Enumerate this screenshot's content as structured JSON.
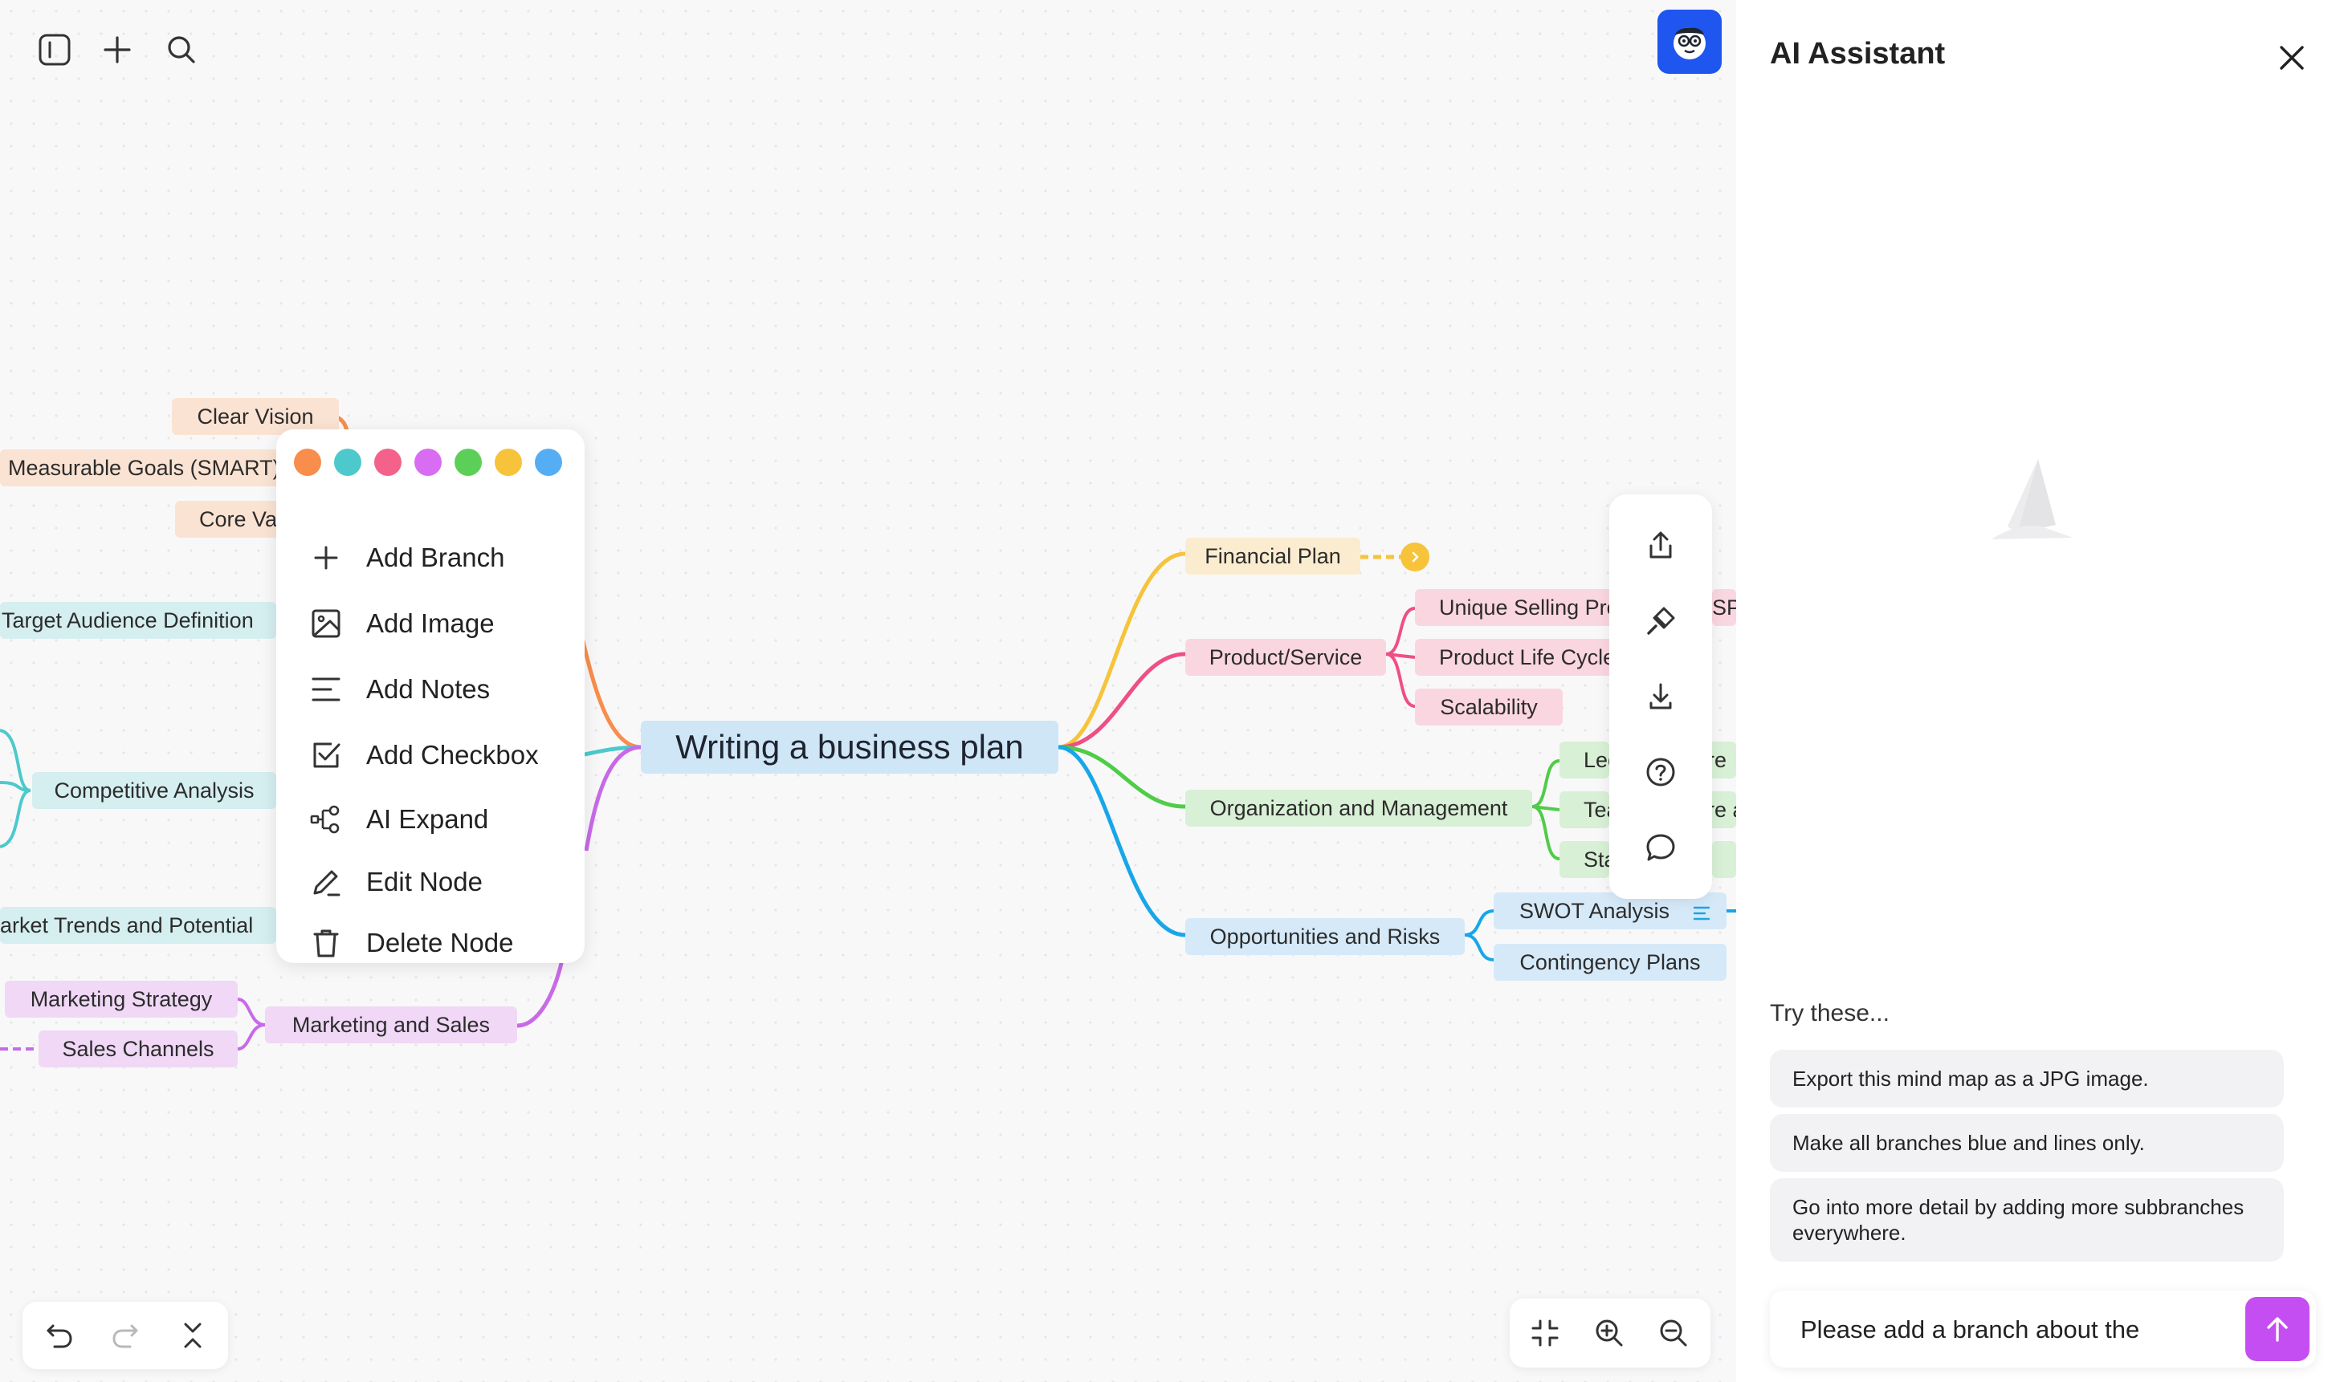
{
  "toolbar": {
    "sidebar_icon": "sidebar-toggle-icon",
    "add_icon": "plus-icon",
    "search_icon": "search-icon"
  },
  "mindmap": {
    "root": "Writing a business plan",
    "left_nodes": {
      "clear_vision": "Clear Vision",
      "measurable_goals": "Measurable Goals (SMART)",
      "core_values": "Core Val",
      "target_audience": "Target Audience Definition",
      "competitive_analysis": "Competitive Analysis",
      "market_trends": "arket Trends and Potential",
      "marketing_strategy": "Marketing Strategy",
      "sales_channels": "Sales Channels",
      "marketing_sales": "Marketing and Sales"
    },
    "right_nodes": {
      "financial_plan": "Financial Plan",
      "product_service": "Product/Service",
      "unique_selling": "Unique Selling Pro",
      "usp_suffix": "SP",
      "product_life_cycle": "Product Life Cycle",
      "scalability": "Scalability",
      "org_management": "Organization and Management",
      "legal_partial": "Leg",
      "legal_suffix": "re",
      "team_partial": "Tea",
      "team_suffix": "re a",
      "staff_partial": "Sta",
      "opportunities_risks": "Opportunities and Risks",
      "swot": "SWOT Analysis",
      "contingency": "Contingency Plans"
    }
  },
  "context_menu": {
    "colors": [
      "#f98d4b",
      "#4dc9cb",
      "#f4628b",
      "#d86cf2",
      "#5ccf58",
      "#f6c33a",
      "#55aef4"
    ],
    "items": [
      {
        "label": "Add Branch",
        "icon": "plus-icon"
      },
      {
        "label": "Add Image",
        "icon": "image-icon"
      },
      {
        "label": "Add Notes",
        "icon": "notes-icon"
      },
      {
        "label": "Add Checkbox",
        "icon": "checkbox-icon"
      },
      {
        "label": "AI Expand",
        "icon": "ai-expand-icon"
      },
      {
        "label": "Edit Node",
        "icon": "pencil-icon"
      },
      {
        "label": "Delete Node",
        "icon": "trash-icon"
      }
    ]
  },
  "side_tools": [
    "share-icon",
    "paint-brush-icon",
    "download-icon",
    "help-icon",
    "comment-icon"
  ],
  "bottom_left": [
    "undo-icon",
    "redo-icon",
    "collapse-icon"
  ],
  "bottom_right": [
    "fit-screen-icon",
    "zoom-in-icon",
    "zoom-out-icon"
  ],
  "assistant": {
    "title": "AI Assistant",
    "try_title": "Try these...",
    "suggestions": [
      "Export this mind map as a JPG image.",
      "Make all branches blue and lines only.",
      "Go into more detail by adding more subbranches everywhere."
    ],
    "input_value": "Please add a branch about the"
  },
  "colors": {
    "accent": "#c54ef2",
    "avatar_bg": "#1f56f0",
    "branch_orange": "#f98d4b",
    "branch_teal": "#4dc9cb",
    "branch_purple": "#c86ae8",
    "branch_yellow": "#f6c33a",
    "branch_pink": "#ef4f84",
    "branch_green": "#4fcc48",
    "branch_blue": "#18a6e8"
  }
}
